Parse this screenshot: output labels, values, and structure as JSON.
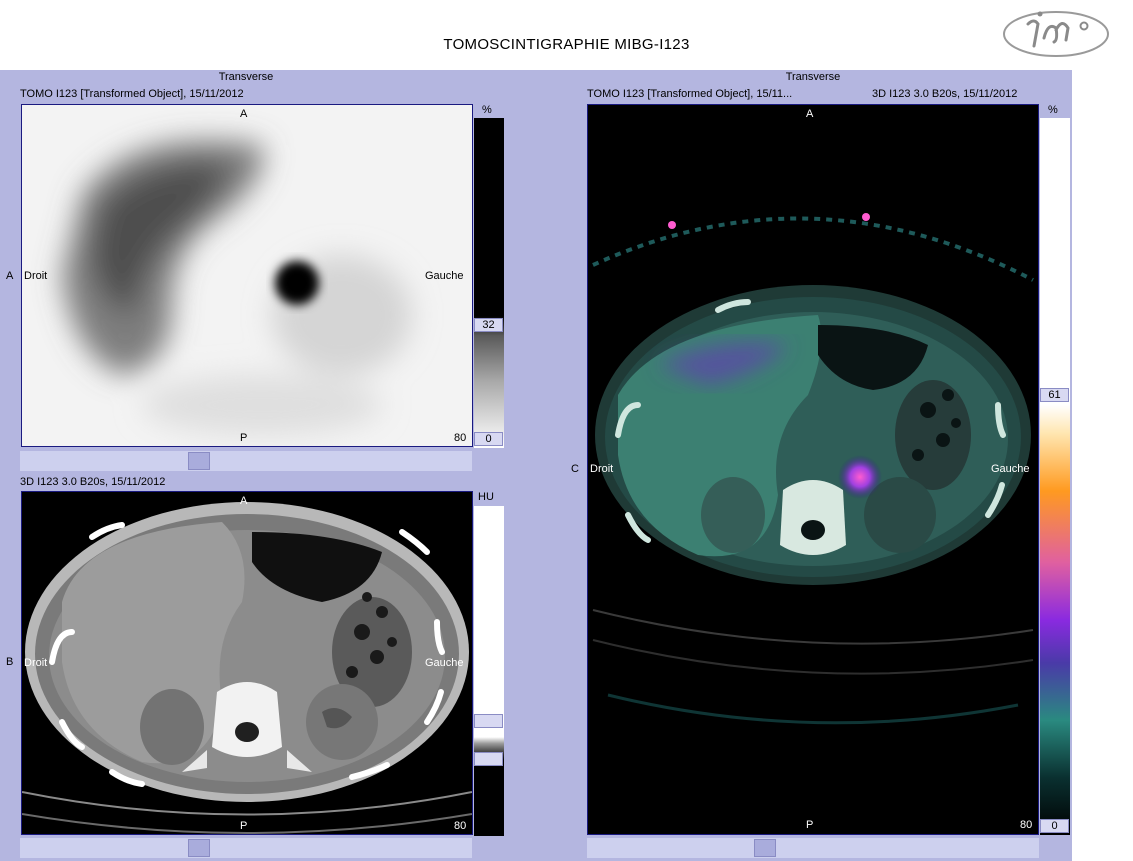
{
  "header": {
    "title": "TOMOSCINTIGRAPHIE MIBG-I123",
    "logo_icon": "im-logo-icon"
  },
  "panel_a": {
    "view_title": "Transverse",
    "series_info": "TOMO I123 [Transformed Object], 15/11/2012",
    "row_label": "A",
    "top": "A",
    "bottom": "P",
    "left": "Droit",
    "right": "Gauche",
    "zoom": "80",
    "colorbar": {
      "unit": "%",
      "max": "32",
      "min": "0"
    }
  },
  "panel_b": {
    "series_info": "3D I123  3.0  B20s, 15/11/2012",
    "row_label": "B",
    "top": "A",
    "bottom": "P",
    "left": "Droit",
    "right": "Gauche",
    "zoom": "80",
    "colorbar": {
      "unit": "HU"
    }
  },
  "panel_c": {
    "view_title": "Transverse",
    "series_info_left": "TOMO I123 [Transformed Object], 15/11...",
    "series_info_right": "3D I123  3.0  B20s, 15/11/2012",
    "row_label": "C",
    "top": "A",
    "bottom": "P",
    "left": "Droit",
    "right": "Gauche",
    "zoom": "80",
    "colorbar": {
      "unit": "%",
      "max": "61",
      "min": "0"
    }
  },
  "colors": {
    "workspace": "#b4b6e0",
    "frame": "#1a1a80",
    "fusion_hotspot": "#b04de0"
  }
}
